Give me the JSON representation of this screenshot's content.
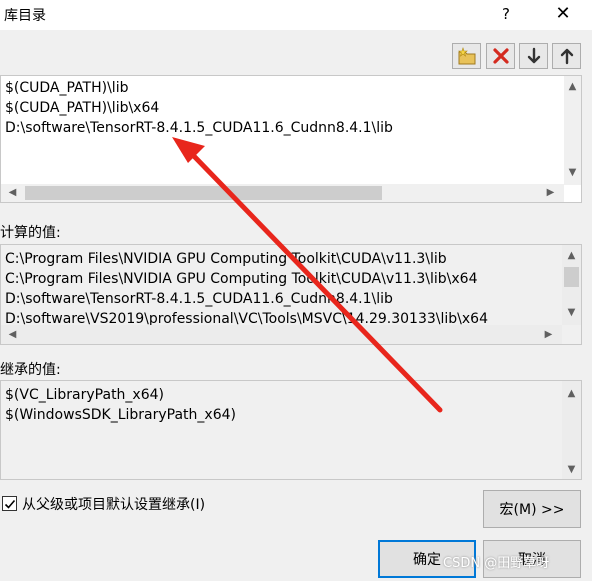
{
  "window": {
    "title": "库目录",
    "help_glyph": "?",
    "close_glyph": "✕"
  },
  "toolbar": {
    "new_line": "new-line-icon",
    "delete": "delete-icon",
    "move_down": "move-down-icon",
    "move_up": "move-up-icon"
  },
  "editor": {
    "lines": [
      "$(CUDA_PATH)\\lib",
      "$(CUDA_PATH)\\lib\\x64",
      "D:\\software\\TensorRT-8.4.1.5_CUDA11.6_Cudnn8.4.1\\lib"
    ]
  },
  "evaluated": {
    "label": "计算的值:",
    "lines": [
      "C:\\Program Files\\NVIDIA GPU Computing Toolkit\\CUDA\\v11.3\\lib",
      "C:\\Program Files\\NVIDIA GPU Computing Toolkit\\CUDA\\v11.3\\lib\\x64",
      "D:\\software\\TensorRT-8.4.1.5_CUDA11.6_Cudnn8.4.1\\lib",
      "D:\\software\\VS2019\\professional\\VC\\Tools\\MSVC\\14.29.30133\\lib\\x64"
    ]
  },
  "inherited": {
    "label": "继承的值:",
    "lines": [
      "$(VC_LibraryPath_x64)",
      "$(WindowsSDK_LibraryPath_x64)"
    ]
  },
  "inherit_checkbox": {
    "label": "从父级或项目默认设置继承(I)",
    "checked": true
  },
  "buttons": {
    "macros": "宏(M) >>",
    "ok": "确定",
    "cancel": "取消"
  },
  "watermark": "CSDN @田野草呀",
  "colors": {
    "annotation_arrow": "#e8261c",
    "default_button_border": "#0078d7"
  }
}
